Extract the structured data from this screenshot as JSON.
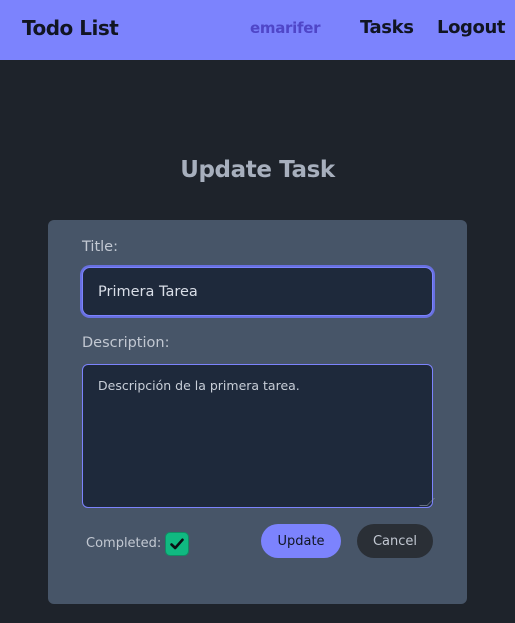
{
  "navbar": {
    "brand": "Todo List",
    "username": "emarifer",
    "tasks_link": "Tasks",
    "logout_link": "Logout",
    "background_color": "#7c83fd"
  },
  "page": {
    "title": "Update Task"
  },
  "form": {
    "title_label": "Title:",
    "title_value": "Primera Tarea",
    "description_label": "Description:",
    "description_value": "Descripción de la primera tarea.",
    "completed_label": "Completed:",
    "completed_checked": true,
    "update_button": "Update",
    "cancel_button": "Cancel",
    "accent_color": "#7c83fd",
    "checkbox_color": "#10b981"
  },
  "icons": {
    "checkbox": "checkmark-icon"
  }
}
